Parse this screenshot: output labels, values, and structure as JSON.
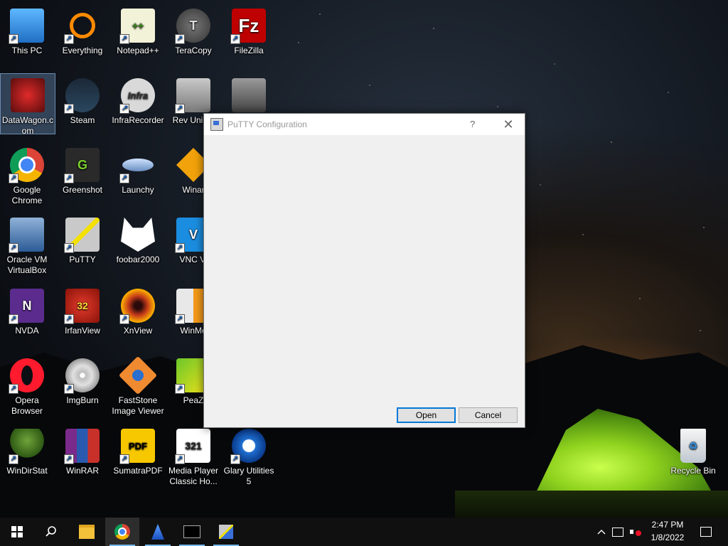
{
  "desktop": {
    "icons": [
      {
        "label": "This PC"
      },
      {
        "label": "Everything"
      },
      {
        "label": "Notepad++"
      },
      {
        "label": "TeraCopy"
      },
      {
        "label": "FileZilla"
      },
      {
        "label": "DataWagon.c om"
      },
      {
        "label": "Steam"
      },
      {
        "label": "InfraRecorder"
      },
      {
        "label": "Rev Uninst"
      },
      {
        "label": "Google Chrome"
      },
      {
        "label": "Greenshot"
      },
      {
        "label": "Launchy"
      },
      {
        "label": "Winar"
      },
      {
        "label": "Oracle VM VirtualBox"
      },
      {
        "label": "PuTTY"
      },
      {
        "label": "foobar2000"
      },
      {
        "label": "VNC Vi"
      },
      {
        "label": "NVDA"
      },
      {
        "label": "IrfanView"
      },
      {
        "label": "XnView"
      },
      {
        "label": "WinMe"
      },
      {
        "label": "Opera Browser"
      },
      {
        "label": "ImgBurn"
      },
      {
        "label": "FastStone Image Viewer"
      },
      {
        "label": "PeaZ"
      },
      {
        "label": "WinDirStat"
      },
      {
        "label": "WinRAR"
      },
      {
        "label": "SumatraPDF"
      },
      {
        "label": "Media Player Classic Ho..."
      },
      {
        "label": "Glary Utilities 5"
      },
      {
        "label": "Recycle Bin"
      }
    ]
  },
  "dialog": {
    "title": "PuTTY Configuration",
    "help": "?",
    "close": "✕",
    "open_label": "Open",
    "cancel_label": "Cancel"
  },
  "taskbar": {
    "time": "2:47 PM",
    "date": "1/8/2022"
  }
}
